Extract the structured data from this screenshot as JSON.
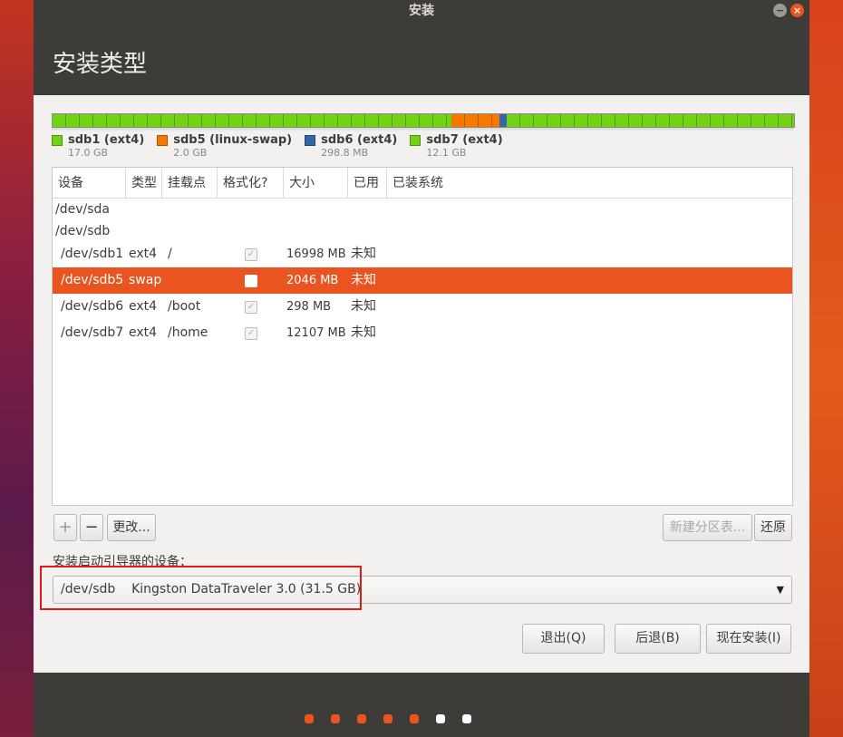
{
  "window": {
    "title": "安装"
  },
  "page": {
    "title": "安装类型"
  },
  "partition_bar": {
    "segments": [
      {
        "name": "sdb1",
        "fraction": 0.538,
        "color": "#73d216"
      },
      {
        "name": "sdb5",
        "fraction": 0.065,
        "color": "#f57900"
      },
      {
        "name": "sdb6",
        "fraction": 0.009,
        "color": "#3465a4"
      },
      {
        "name": "sdb7",
        "fraction": 0.388,
        "color": "#73d216"
      }
    ]
  },
  "legend": [
    {
      "label": "sdb1 (ext4)",
      "size": "17.0 GB",
      "color": "#73d216"
    },
    {
      "label": "sdb5 (linux-swap)",
      "size": "2.0 GB",
      "color": "#f57900"
    },
    {
      "label": "sdb6 (ext4)",
      "size": "298.8 MB",
      "color": "#3465a4"
    },
    {
      "label": "sdb7 (ext4)",
      "size": "12.1 GB",
      "color": "#73d216"
    }
  ],
  "table": {
    "headers": [
      "设备",
      "类型",
      "挂载点",
      "格式化?",
      "大小",
      "已用",
      "已装系统"
    ],
    "devices": [
      "/dev/sda",
      "/dev/sdb"
    ],
    "rows": [
      {
        "device": "/dev/sdb1",
        "type": "ext4",
        "mount": "/",
        "format": "✓",
        "size": "16998 MB",
        "used": "未知"
      },
      {
        "device": "/dev/sdb5",
        "type": "swap",
        "mount": "",
        "format": "",
        "size": "2046 MB",
        "used": "未知"
      },
      {
        "device": "/dev/sdb6",
        "type": "ext4",
        "mount": "/boot",
        "format": "✓",
        "size": "298 MB",
        "used": "未知"
      },
      {
        "device": "/dev/sdb7",
        "type": "ext4",
        "mount": "/home",
        "format": "✓",
        "size": "12107 MB",
        "used": "未知"
      }
    ]
  },
  "toolbar": {
    "add": "+",
    "remove": "−",
    "change": "更改...",
    "new_table": "新建分区表...",
    "revert": "还原"
  },
  "boot": {
    "label": "安装启动引导器的设备：",
    "selected": "/dev/sdb    Kingston DataTraveler 3.0 (31.5 GB)",
    "arrow": "▼"
  },
  "buttons": {
    "quit": "退出(Q)",
    "back": "后退(B)",
    "install": "现在安装(I)"
  },
  "titlebar": {
    "minimize": "−",
    "close": "×"
  },
  "progress_dots": [
    "#e95420",
    "#e95420",
    "#e95420",
    "#e95420",
    "#e95420",
    "#ffffff",
    "#ffffff"
  ]
}
